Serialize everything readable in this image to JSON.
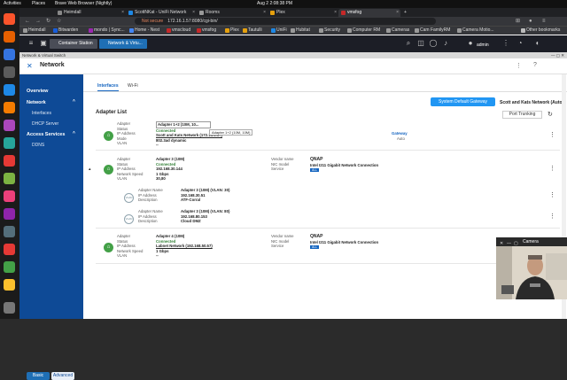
{
  "os": {
    "activities": "Activities",
    "places": "Places",
    "app": "Brave Web Browser (Nightly)",
    "clock": "Aug 2  2:08:38 PM"
  },
  "browser": {
    "tabs": [
      {
        "label": "Heimdall",
        "color": "#888"
      },
      {
        "label": "ScottNKat - UniFi Network",
        "color": "#1e88e5"
      },
      {
        "label": "Rooms",
        "color": "#999"
      },
      {
        "label": "Plex",
        "color": "#e5a00d"
      },
      {
        "label": "vmsfog",
        "color": "#c62828"
      }
    ],
    "new_tab": "+",
    "url_warning": "Not secure",
    "url": "172.16.1.57:8080/cgi-bin/",
    "bookmarks": [
      "Heimdall",
      "Bitwarden",
      "mondo | Sync...",
      "Home - Nest",
      "vmscloud",
      "vmsfog",
      "Plex",
      "Tautulli",
      "UniFi",
      "Hubitat",
      "Security",
      "Computer RM",
      "Cameras",
      "Cam FamilyRM",
      "Camera Motio..."
    ],
    "other_bookmarks": "Other bookmarks"
  },
  "app": {
    "tabs": [
      "Container Station",
      "Network & Virtu..."
    ],
    "user": "admin",
    "subbar_title": "Network & Virtual Switch",
    "page_title": "Network"
  },
  "sidebar": {
    "overview": "Overview",
    "network": "Network",
    "interfaces": "Interfaces",
    "dhcp": "DHCP Server",
    "access_services": "Access Services",
    "ddns": "DDNS",
    "basic": "Basic",
    "advanced": "Advanced"
  },
  "content": {
    "tab_interfaces": "Interfaces",
    "tab_wifi": "Wi-Fi",
    "gateway_button": "System Default Gateway",
    "gateway_name": "Scott and Kats Network (Auto)",
    "adapter_list": "Adapter List",
    "port_trunking": "Port Trunking"
  },
  "labels": {
    "adapter": "Adapter",
    "status": "Status",
    "ip": "IP Address",
    "mode": "Mode",
    "vlan": "VLAN",
    "speed": "Network Speed",
    "vendor": "Vendor name",
    "nic": "NIC model",
    "service": "Service",
    "adapter_name": "Adapter Name",
    "description": "Description"
  },
  "adapters": [
    {
      "name": "Adapter 1+2 (10M, 10...",
      "status": "Connected",
      "ip": "Scott and Kats Network (172.16.1.57)",
      "mode": "802.3ad dynamic",
      "vlan": "--",
      "tooltip": "Adapter 1+2 (10M, 10M)",
      "gateway": "Gateway",
      "gateway_mode": "Auto"
    },
    {
      "name": "Adapter 3 (10M)",
      "status": "Connected",
      "ip": "192.168.30.144",
      "speed": "1 Gbps",
      "vlan": "30,80",
      "vendor": "QNAP",
      "nic": "Intel I211 Gigabit Network Connection",
      "service": "ALL"
    },
    {
      "name": "Adapter 4 (10M)",
      "status": "Connected",
      "ip": "Labnet Network (192.168.50.57)",
      "speed": "1 Gbps",
      "vlan": "--",
      "vendor": "QNAP",
      "nic": "Intel I211 Gigabit Network Connection",
      "service": "ALL"
    }
  ],
  "vlans": [
    {
      "badge": "VLAN",
      "name": "Adapter 3 (10M) (VLAN: 30)",
      "ip": "192.168.30.51",
      "desc": "ATF-Corral"
    },
    {
      "badge": "VLAN",
      "name": "Adapter 3 (10M) (VLAN: 80)",
      "ip": "192.168.80.153",
      "desc": "Cloud DMZ"
    }
  ],
  "camera": {
    "title": "Camera"
  }
}
